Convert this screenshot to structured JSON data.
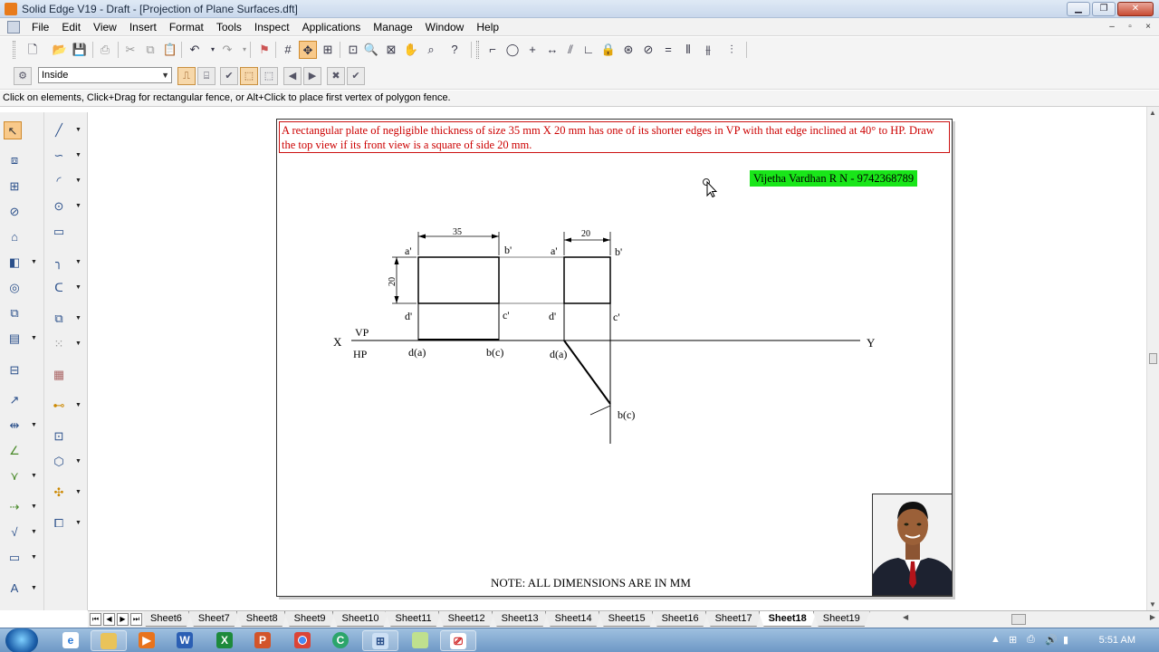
{
  "window": {
    "title": "Solid Edge V19 - Draft - [Projection of Plane Surfaces.dft]",
    "min_label": "▁",
    "max_label": "❐",
    "close_label": "✕"
  },
  "menubar": {
    "items": [
      "File",
      "Edit",
      "View",
      "Insert",
      "Format",
      "Tools",
      "Inspect",
      "Applications",
      "Manage",
      "Window",
      "Help"
    ],
    "mdi_min": "–",
    "mdi_restore": "▫",
    "mdi_close": "×"
  },
  "toolbar2": {
    "select_value": "Inside"
  },
  "prompt": {
    "text": "Click on elements, Click+Drag for rectangular fence, or Alt+Click to place first vertex of polygon fence."
  },
  "sheet": {
    "problem_text": "A rectangular plate of negligible thickness of size 35 mm X 20 mm has one of its shorter edges in VP with that edge inclined at 40° to HP. Draw the top view if its front view is a square of side 20 mm.",
    "author": "Vijetha Vardhan R N - 9742368789",
    "note": "NOTE: ALL DIMENSIONS ARE IN MM",
    "highlight_color": "#19e619",
    "problem_color": "#cc0000"
  },
  "drawing": {
    "dim_35": "35",
    "dim_20_top": "20",
    "dim_20_side": "20",
    "x_label": "X",
    "y_label": "Y",
    "vp_label": "VP",
    "hp_label": "HP",
    "view1": {
      "a": "a'",
      "b": "b'",
      "c": "c'",
      "d": "d'",
      "top_left": "d(a)",
      "top_right": "b(c)"
    },
    "view2": {
      "a": "a'",
      "b": "b'",
      "c": "c'",
      "d": "d'",
      "top_left": "d(a)",
      "top_right": "b(c)"
    }
  },
  "sheet_tabs": {
    "tabs": [
      "Sheet6",
      "Sheet7",
      "Sheet8",
      "Sheet9",
      "Sheet10",
      "Sheet11",
      "Sheet12",
      "Sheet13",
      "Sheet14",
      "Sheet15",
      "Sheet16",
      "Sheet17",
      "Sheet18",
      "Sheet19"
    ],
    "active": "Sheet18"
  },
  "taskbar": {
    "clock": "5:51 AM"
  }
}
